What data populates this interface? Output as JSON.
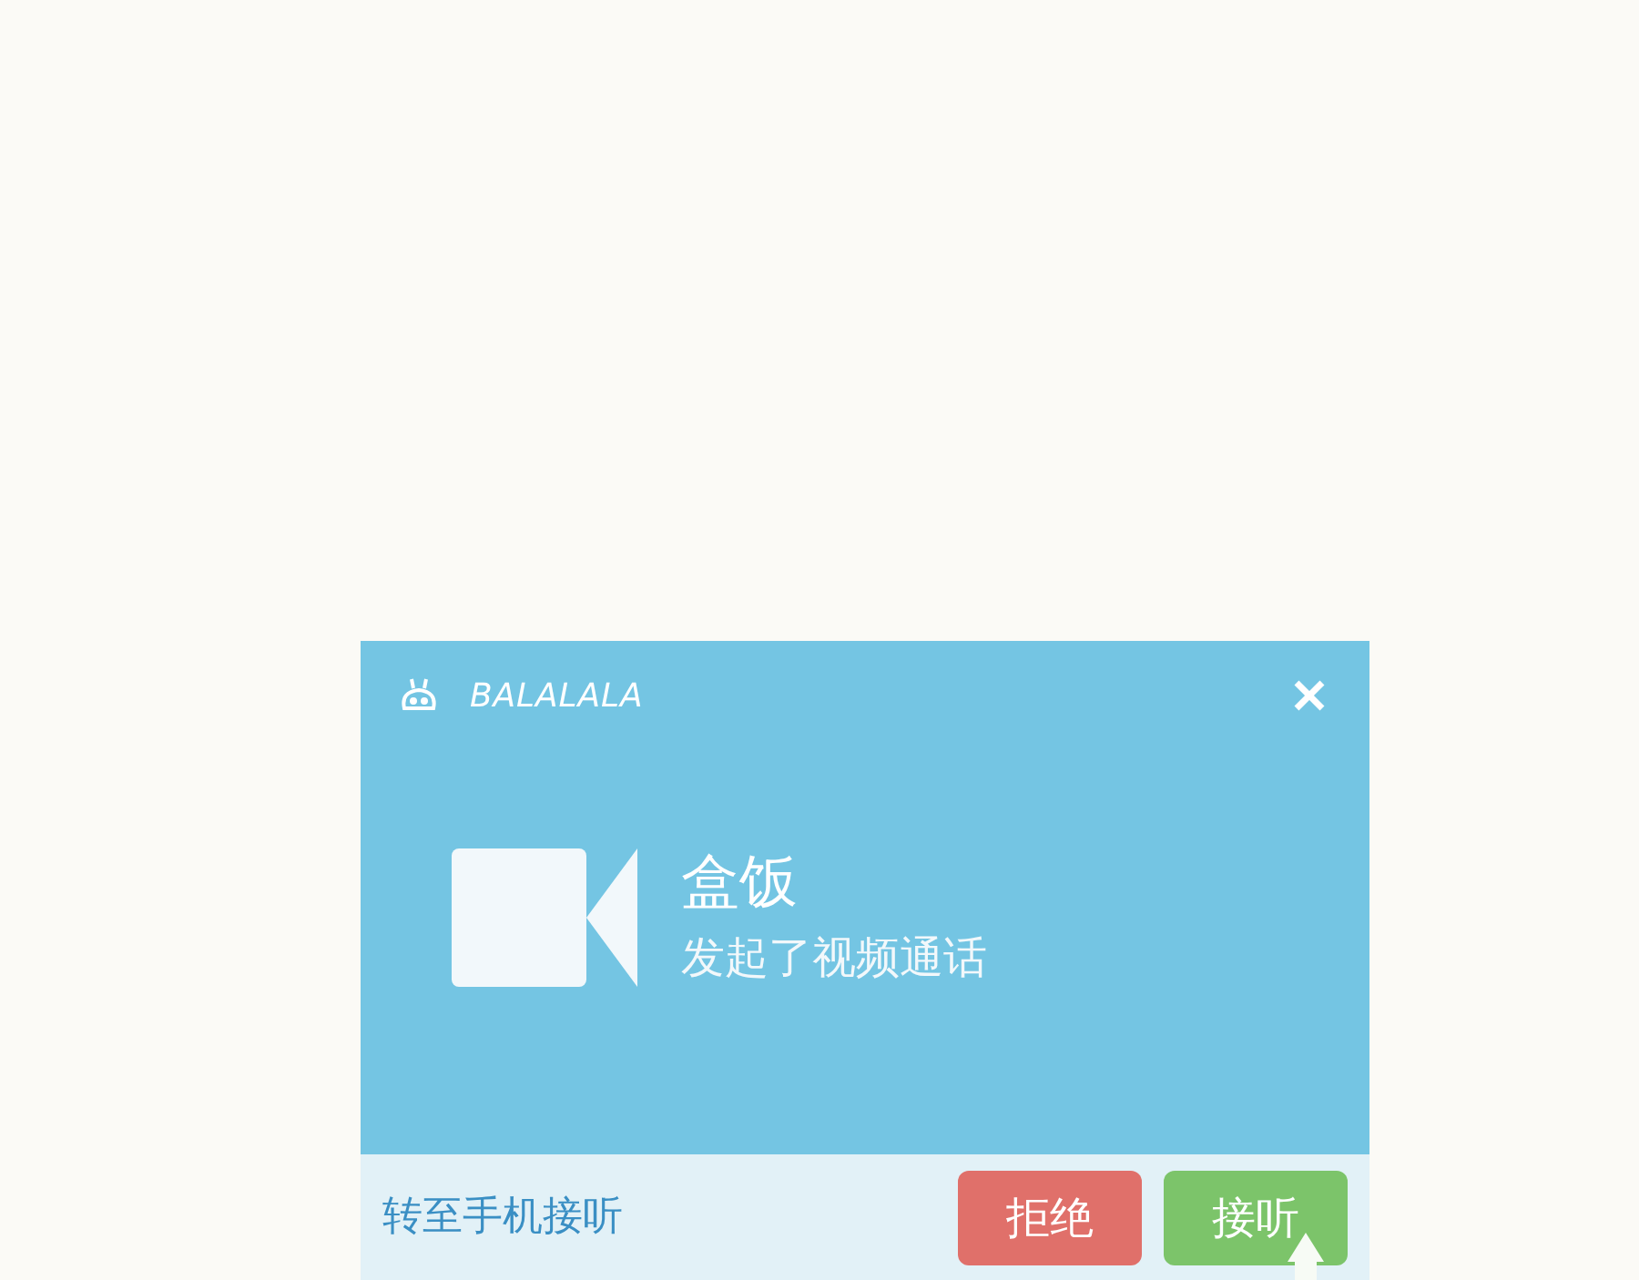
{
  "window": {
    "title": "BALALALA"
  },
  "call": {
    "caller": "盒饭",
    "message": "发起了视频通话"
  },
  "footer": {
    "transfer_link": "转至手机接听",
    "buttons": [
      {
        "label": "拒绝",
        "kind": "decline"
      },
      {
        "label": "接听",
        "kind": "accept"
      }
    ]
  }
}
